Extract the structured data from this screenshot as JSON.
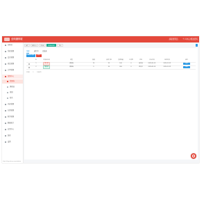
{
  "header": {
    "brand": "全网通商城",
    "user_label": "超级管理员",
    "link_label": "个人中心/修改密码"
  },
  "sidebar": {
    "items": [
      {
        "label": "控制台"
      },
      {
        "label": "系统管理"
      },
      {
        "label": "会员管理"
      },
      {
        "label": "商品管理"
      },
      {
        "label": "订单管理"
      },
      {
        "label": "营销中心"
      },
      {
        "label": "优惠券",
        "sub": true
      },
      {
        "label": "满减送",
        "sub": true
      },
      {
        "label": "拼团",
        "sub": true
      },
      {
        "label": "秒杀",
        "sub": true
      },
      {
        "label": "内容管理"
      },
      {
        "label": "分销管理"
      },
      {
        "label": "财务管理"
      },
      {
        "label": "数据统计"
      },
      {
        "label": "应用中心"
      },
      {
        "label": "装修"
      },
      {
        "label": "设置"
      }
    ],
    "footer_url": "http://shop.demo.com/admin"
  },
  "breadcrumb": {
    "items": [
      "首页",
      "营销中心",
      "优惠券",
      "优惠券列表",
      "添加"
    ]
  },
  "tabs": [
    "全部",
    "进行中",
    "已结束"
  ],
  "buttons": {
    "add": "添加优惠券",
    "remove": "删除"
  },
  "table": {
    "headers": [
      "",
      "ID",
      "优惠券名称",
      "类型",
      "面值",
      "使用门槛",
      "发放数量",
      "已领取",
      "状态",
      "开始时间",
      "结束时间",
      "操作"
    ],
    "rows": [
      {
        "id": "1",
        "name": "新人券",
        "type": "满减券",
        "value": "10",
        "threshold": "99",
        "total": "100",
        "received": "0",
        "status": "未开始",
        "start": "2020-01-01",
        "end": "2020-12-31",
        "action": "编辑"
      },
      {
        "id": "2",
        "name": "通用券",
        "type": "满减券",
        "value": "5",
        "threshold": "50",
        "total": "200",
        "received": "0",
        "status": "进行中",
        "start": "2020-01-01",
        "end": "2020-12-31",
        "action": "编辑"
      }
    ]
  },
  "pager": {
    "total": "共2条",
    "page": "1",
    "page_size": "10条/页"
  },
  "colors": {
    "brand": "#e4483b",
    "accent": "#2f9be4",
    "success": "#1aad8f"
  },
  "icons": {
    "fab": "chat-icon",
    "refresh": "refresh-icon"
  }
}
